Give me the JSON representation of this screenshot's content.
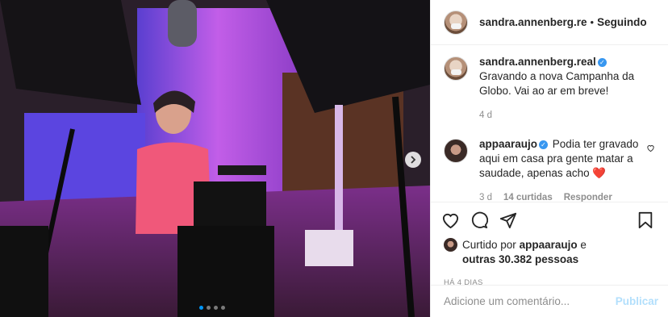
{
  "post": {
    "author": "sandra.annenberg.re",
    "separator": "•",
    "follow_status": "Seguindo"
  },
  "caption": {
    "author": "sandra.annenberg.real",
    "verified_icon": "verified-badge-icon",
    "text": "Gravando a nova Campanha da Globo. Vai ao ar em breve!",
    "age": "4 d"
  },
  "comments": [
    {
      "author": "appaaraujo",
      "verified_icon": "verified-badge-icon",
      "text": "Podia ter gravado aqui em casa pra gente matar a saudade, apenas acho ❤️",
      "age": "3 d",
      "likes": "14 curtidas",
      "reply_label": "Responder"
    }
  ],
  "actions": {
    "like_icon": "heart-icon",
    "comment_icon": "comment-icon",
    "share_icon": "share-icon",
    "save_icon": "bookmark-icon"
  },
  "likes": {
    "prefix": "Curtido por",
    "user": "appaaraujo",
    "mid": "e",
    "others": "outras 30.382 pessoas"
  },
  "timestamp": "HÁ 4 DIAS",
  "add_comment": {
    "placeholder": "Adicione um comentário...",
    "publish_label": "Publicar"
  },
  "carousel": {
    "slides": 4,
    "active": 0
  },
  "colors": {
    "accent": "#0095f6",
    "verified": "#3897f0",
    "publish_disabled": "#b2dffc",
    "heart": "#ed4956"
  }
}
